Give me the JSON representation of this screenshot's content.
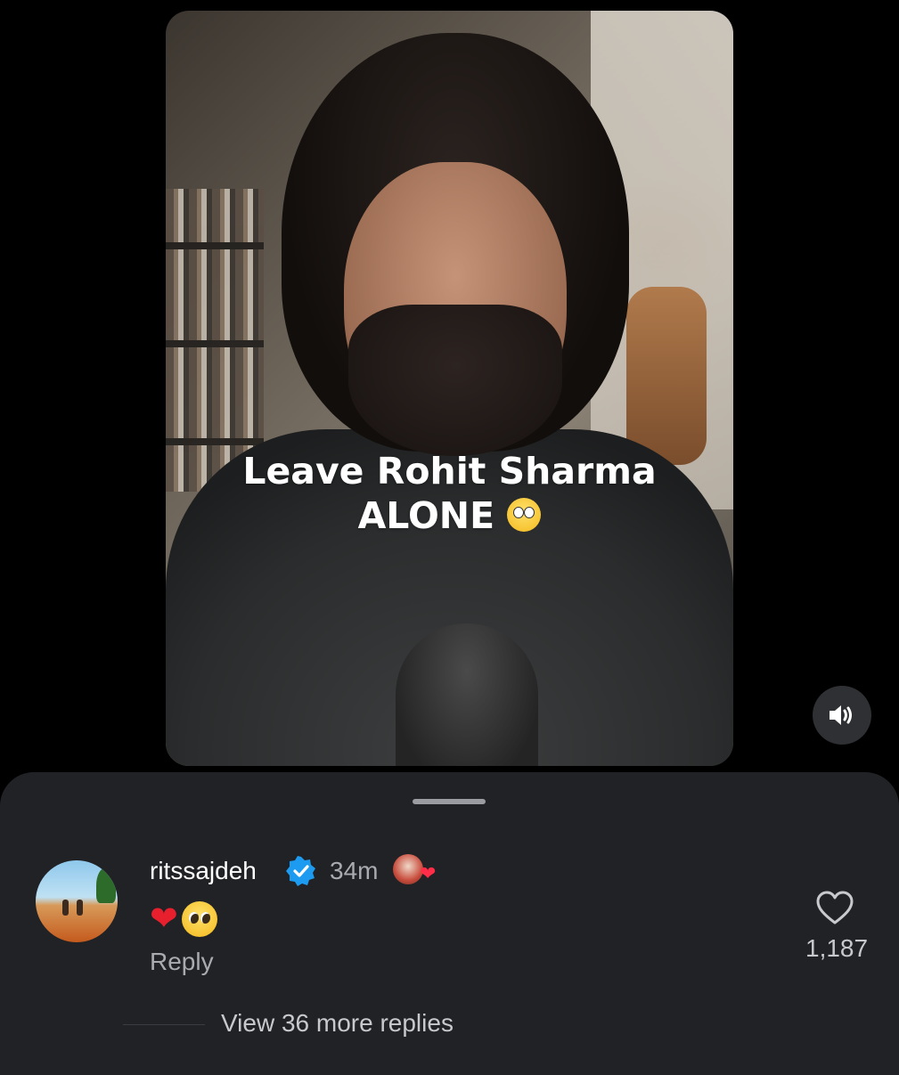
{
  "video": {
    "caption_line1": "Leave Rohit Sharma",
    "caption_line2": "ALONE",
    "caption_emoji": "face-with-rolling-eyes-emoji"
  },
  "sound_button": {
    "icon": "speaker-icon"
  },
  "comment": {
    "username": "ritssajdeh",
    "verified": true,
    "time": "34m",
    "body_emojis": [
      "red-heart-emoji",
      "pleading-face-emoji"
    ],
    "reply_label": "Reply",
    "like_count": "1,187"
  },
  "view_more_replies": "View 36 more replies",
  "colors": {
    "background": "#000000",
    "sheet": "#202226",
    "verified_badge": "#1d9bf0",
    "heart": "#e8202d"
  }
}
